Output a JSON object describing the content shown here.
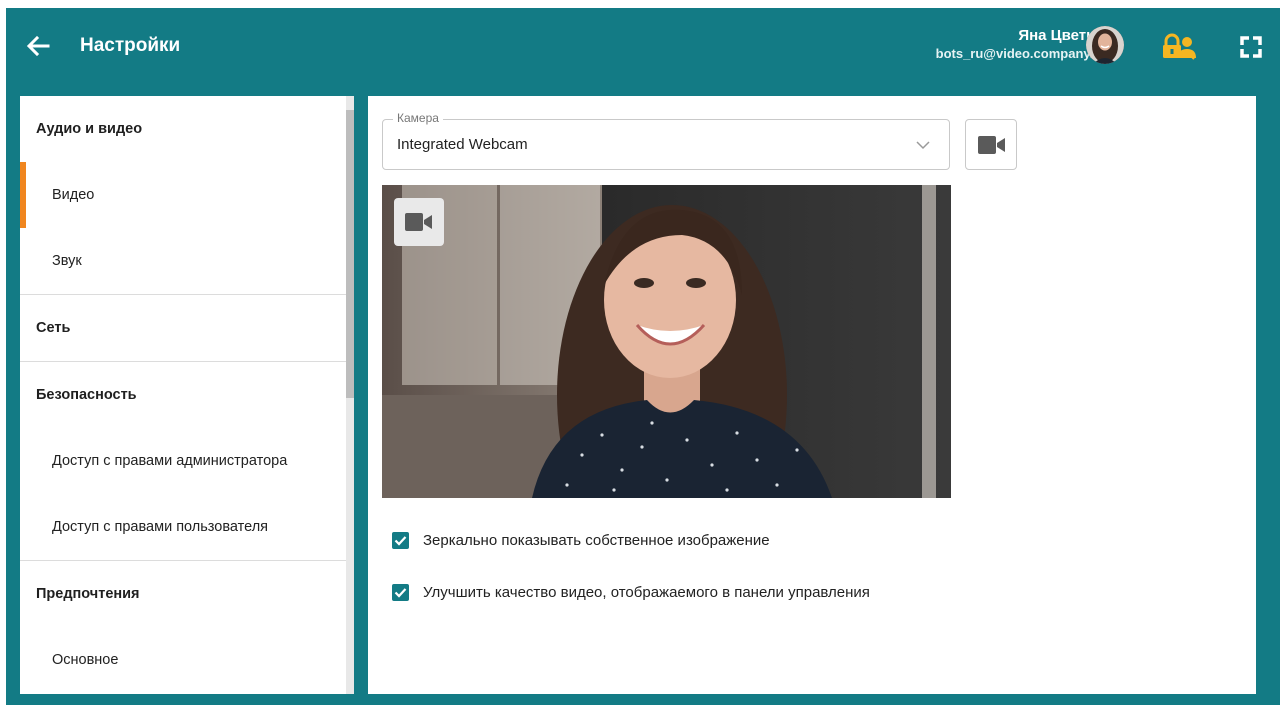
{
  "header": {
    "title": "Настройки",
    "user_name": "Яна Цветкова",
    "user_email": "bots_ru@video.company.com",
    "icons": {
      "back": "arrow-left-icon",
      "avatar": "user-avatar",
      "lock": "lock-user-icon",
      "fullscreen": "fullscreen-icon"
    }
  },
  "sidebar": {
    "sections": [
      {
        "label": "Аудио и видео",
        "items": [
          {
            "label": "Видео",
            "active": true
          },
          {
            "label": "Звук",
            "active": false
          }
        ]
      },
      {
        "label": "Сеть",
        "items": []
      },
      {
        "label": "Безопасность",
        "items": [
          {
            "label": "Доступ с правами администратора",
            "active": false
          },
          {
            "label": "Доступ с правами пользователя",
            "active": false
          }
        ]
      },
      {
        "label": "Предпочтения",
        "items": [
          {
            "label": "Основное",
            "active": false
          }
        ]
      }
    ]
  },
  "main": {
    "camera": {
      "label": "Камера",
      "value": "Integrated Webcam"
    },
    "options": [
      {
        "label": "Зеркально показывать собственное изображение",
        "checked": true
      },
      {
        "label": "Улучшить качество видео, отображаемого в панели управления",
        "checked": true
      }
    ]
  },
  "colors": {
    "brand": "#137b85",
    "accent": "#f0861f",
    "lock_icon": "#f5b622"
  }
}
